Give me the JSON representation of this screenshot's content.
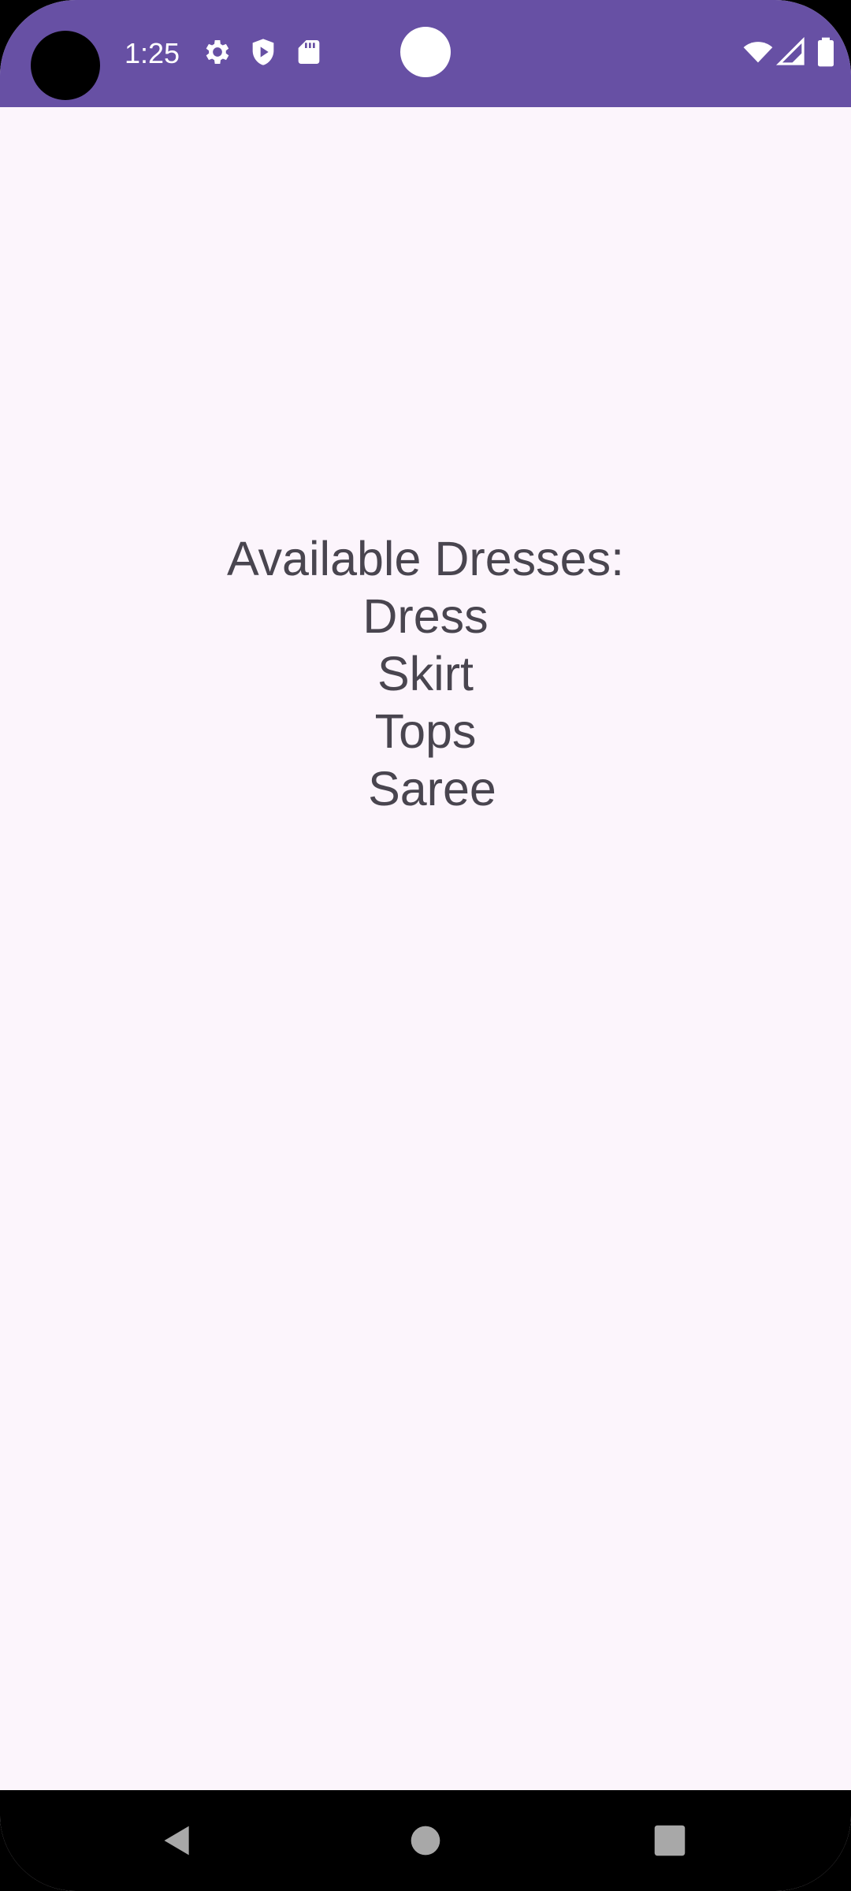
{
  "status_bar": {
    "time": "1:25",
    "icons": [
      "settings-icon",
      "play-protect-icon",
      "sd-card-icon",
      "wifi-icon",
      "cellular-signal-icon",
      "battery-icon"
    ]
  },
  "main": {
    "text": "Available Dresses:\nDress\nSkirt\nTops\n Saree"
  },
  "nav_bar": {
    "buttons": [
      "back-button",
      "home-button",
      "recents-button"
    ]
  },
  "colors": {
    "status_bar": "#6750A4",
    "background": "#FCF5FC",
    "text": "#49454F",
    "nav_bar": "#000000"
  }
}
